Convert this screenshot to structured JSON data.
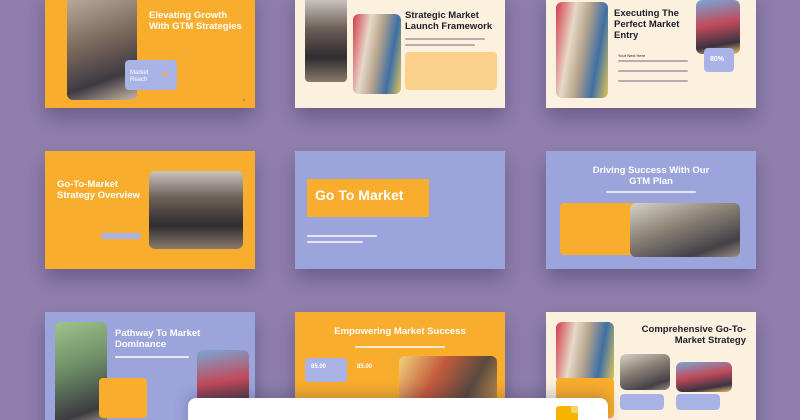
{
  "slides": {
    "s1": {
      "title": "Elevating Growth With GTM Strategies",
      "callout": "Market Reach",
      "num": "4"
    },
    "s2": {
      "title": "Strategic Market Launch Framework"
    },
    "s3": {
      "title": "Executing The Perfect Market Entry",
      "sub": "Your Next Here",
      "stat": "80%"
    },
    "s4": {
      "title": "Go-To-Market Strategy Overview"
    },
    "s5": {
      "title": "Go To Market"
    },
    "s6": {
      "title": "Driving Success With Our GTM Plan"
    },
    "s7": {
      "title": "Pathway To Market Dominance"
    },
    "s8": {
      "title": "Empowering Market Success",
      "stat1": "85.00",
      "stat2": "85.00"
    },
    "s9": {
      "title": "Comprehensive Go-To-Market Strategy"
    }
  },
  "colors": {
    "background": "#8f7fad",
    "orange": "#f9ad2d",
    "cream": "#fcf0df",
    "lavender": "#9ca4dc"
  }
}
